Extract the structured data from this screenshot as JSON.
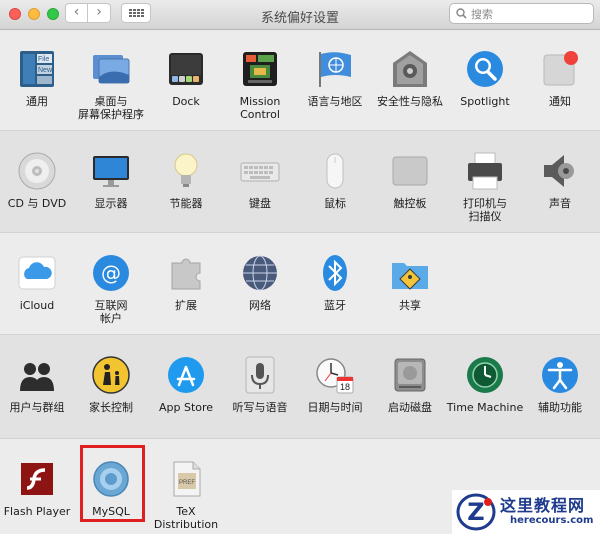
{
  "window": {
    "title": "系统偏好设置",
    "search_placeholder": "搜索"
  },
  "sections": [
    {
      "items": [
        {
          "label": "通用",
          "icon": "general-icon"
        },
        {
          "label": "桌面与\n屏幕保护程序",
          "icon": "desktop-screensaver-icon"
        },
        {
          "label": "Dock",
          "icon": "dock-icon"
        },
        {
          "label": "Mission\nControl",
          "icon": "mission-control-icon"
        },
        {
          "label": "语言与地区",
          "icon": "language-region-icon"
        },
        {
          "label": "安全性与隐私",
          "icon": "security-privacy-icon"
        },
        {
          "label": "Spotlight",
          "icon": "spotlight-icon"
        },
        {
          "label": "通知",
          "icon": "notifications-icon"
        }
      ]
    },
    {
      "items": [
        {
          "label": "CD 与 DVD",
          "icon": "cd-dvd-icon"
        },
        {
          "label": "显示器",
          "icon": "displays-icon"
        },
        {
          "label": "节能器",
          "icon": "energy-saver-icon"
        },
        {
          "label": "键盘",
          "icon": "keyboard-icon"
        },
        {
          "label": "鼠标",
          "icon": "mouse-icon"
        },
        {
          "label": "触控板",
          "icon": "trackpad-icon"
        },
        {
          "label": "打印机与\n扫描仪",
          "icon": "printers-scanners-icon"
        },
        {
          "label": "声音",
          "icon": "sound-icon"
        }
      ]
    },
    {
      "items": [
        {
          "label": "iCloud",
          "icon": "icloud-icon"
        },
        {
          "label": "互联网\n帐户",
          "icon": "internet-accounts-icon"
        },
        {
          "label": "扩展",
          "icon": "extensions-icon"
        },
        {
          "label": "网络",
          "icon": "network-icon"
        },
        {
          "label": "蓝牙",
          "icon": "bluetooth-icon"
        },
        {
          "label": "共享",
          "icon": "sharing-icon"
        }
      ]
    },
    {
      "items": [
        {
          "label": "用户与群组",
          "icon": "users-groups-icon"
        },
        {
          "label": "家长控制",
          "icon": "parental-controls-icon"
        },
        {
          "label": "App Store",
          "icon": "app-store-icon"
        },
        {
          "label": "听写与语音",
          "icon": "dictation-speech-icon"
        },
        {
          "label": "日期与时间",
          "icon": "date-time-icon"
        },
        {
          "label": "启动磁盘",
          "icon": "startup-disk-icon"
        },
        {
          "label": "Time Machine",
          "icon": "time-machine-icon"
        },
        {
          "label": "辅助功能",
          "icon": "accessibility-icon"
        }
      ]
    },
    {
      "items": [
        {
          "label": "Flash Player",
          "icon": "flash-player-icon"
        },
        {
          "label": "MySQL",
          "icon": "mysql-icon",
          "highlighted": true
        },
        {
          "label": "TeX\nDistribution",
          "icon": "tex-distribution-icon"
        }
      ]
    }
  ],
  "calendar_icon_day": "18",
  "watermark": {
    "title": "这里教程网",
    "url": "herecours.com"
  },
  "colors": {
    "highlight_frame": "#e02020",
    "watermark": "#1e3b8e"
  }
}
